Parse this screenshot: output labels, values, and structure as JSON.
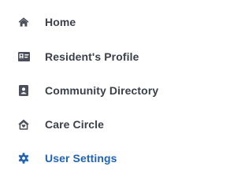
{
  "nav": {
    "items": [
      {
        "label": "Home",
        "icon": "home-icon",
        "active": false
      },
      {
        "label": "Resident's Profile",
        "icon": "id-card-icon",
        "active": false
      },
      {
        "label": "Community Directory",
        "icon": "address-book-icon",
        "active": false
      },
      {
        "label": "Care Circle",
        "icon": "house-heart-icon",
        "active": false
      },
      {
        "label": "User Settings",
        "icon": "gear-icon",
        "active": true
      }
    ]
  },
  "colors": {
    "text": "#3a3f4a",
    "icon": "#4a4f59",
    "active": "#1f63b1"
  }
}
